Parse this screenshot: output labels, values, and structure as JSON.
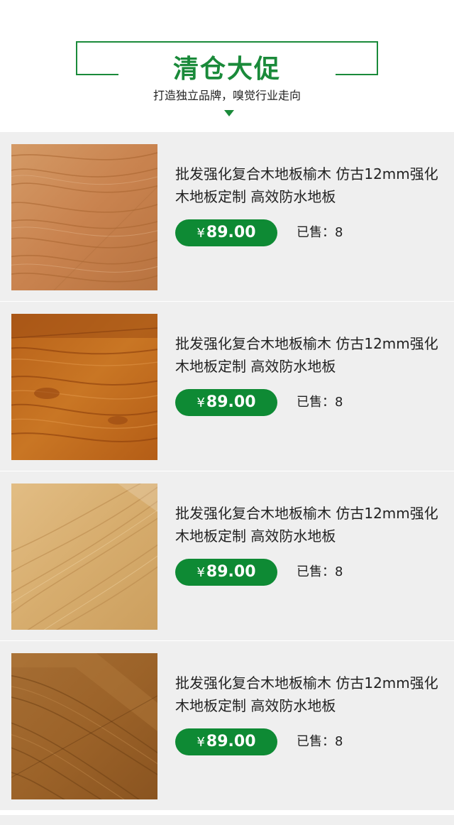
{
  "section": {
    "title": "清仓大促",
    "subtitle": "打造独立品牌，嗅觉行业走向"
  },
  "products": [
    {
      "name": "批发强化复合木地板榆木 仿古12mm强化木地板定制 高效防水地板",
      "currency": "¥",
      "price": "89.00",
      "sold_label": "已售：",
      "sold_count": "8",
      "wood_color": "#c9834f"
    },
    {
      "name": "批发强化复合木地板榆木 仿古12mm强化木地板定制 高效防水地板",
      "currency": "¥",
      "price": "89.00",
      "sold_label": "已售：",
      "sold_count": "8",
      "wood_color": "#c4701e"
    },
    {
      "name": "批发强化复合木地板榆木 仿古12mm强化木地板定制 高效防水地板",
      "currency": "¥",
      "price": "89.00",
      "sold_label": "已售：",
      "sold_count": "8",
      "wood_color": "#d7ad6e"
    },
    {
      "name": "批发强化复合木地板榆木 仿古12mm强化木地板定制 高效防水地板",
      "currency": "¥",
      "price": "89.00",
      "sold_label": "已售：",
      "sold_count": "8",
      "wood_color": "#9c6329"
    }
  ],
  "colors": {
    "accent": "#1a8a3a",
    "price_button": "#0e8a34",
    "card_background": "#efefef"
  }
}
